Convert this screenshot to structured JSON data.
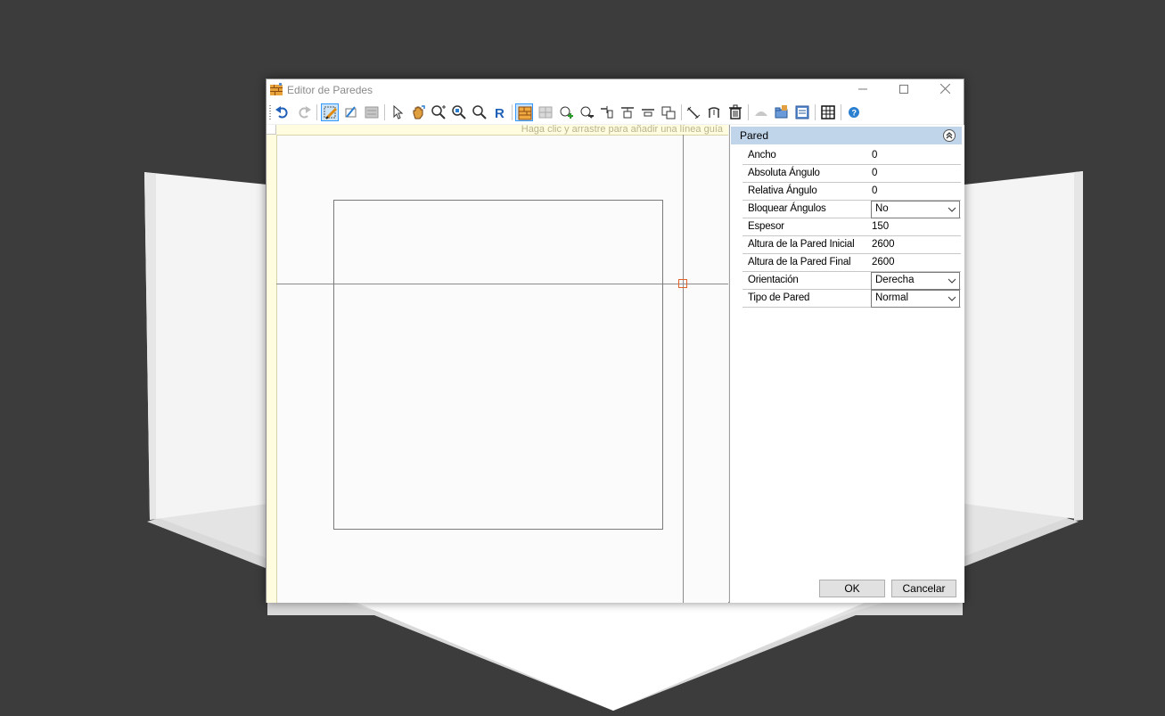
{
  "window": {
    "title": "Editor de Paredes"
  },
  "canvas": {
    "hint": "Haga clic y arrastre para añadir una línea guía"
  },
  "panel": {
    "title": "Pared",
    "properties": [
      {
        "name": "Ancho",
        "value": "0"
      },
      {
        "name": "Absoluta Ángulo",
        "value": "0"
      },
      {
        "name": "Relativa Ángulo",
        "value": "0"
      },
      {
        "name": "Bloquear Ángulos",
        "value": "No"
      },
      {
        "name": "Espesor",
        "value": "150"
      },
      {
        "name": "Altura de la Pared Inicial",
        "value": "2600"
      },
      {
        "name": "Altura de la Pared Final",
        "value": "2600"
      },
      {
        "name": "Orientación",
        "value": "Derecha"
      },
      {
        "name": "Tipo de Pared",
        "value": "Normal"
      }
    ]
  },
  "buttons": {
    "ok": "OK",
    "cancel": "Cancelar"
  },
  "colors": {
    "accent": "#3399ff",
    "panel_header": "#c0d4ea",
    "ruler": "#fffce0",
    "marker": "#e0622a"
  }
}
